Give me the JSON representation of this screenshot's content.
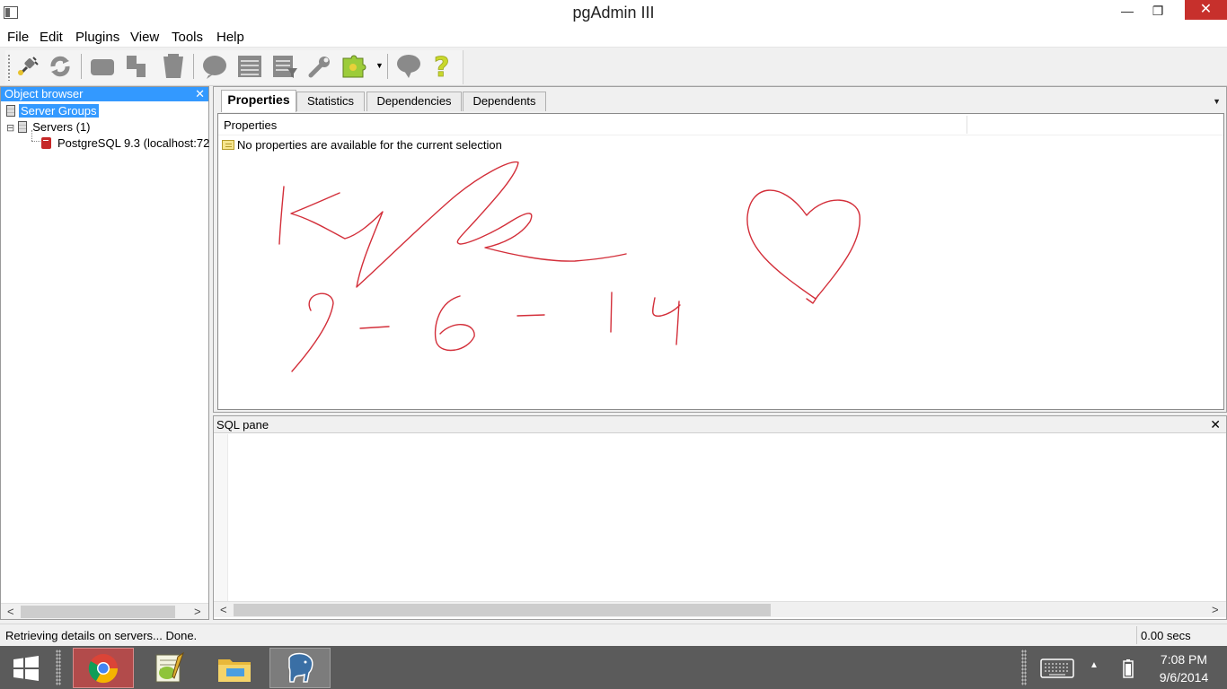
{
  "window": {
    "title": "pgAdmin III"
  },
  "window_controls": {
    "minimize": "—",
    "maximize": "❐",
    "close": "✕"
  },
  "menu": [
    "File",
    "Edit",
    "Plugins",
    "View",
    "Tools",
    "Help"
  ],
  "toolbar": {
    "icons": [
      "connect-icon",
      "refresh-icon",
      "properties-icon",
      "create-object-icon",
      "drop-object-icon",
      "sql-icon",
      "view-data-icon",
      "view-filtered-data-icon",
      "maintenance-icon",
      "plugins-icon",
      "hint-icon",
      "help-icon"
    ]
  },
  "object_browser": {
    "title": "Object browser",
    "close": "✕",
    "tree": {
      "root": "Server Groups",
      "servers": "Servers (1)",
      "server": "PostgreSQL 9.3 (localhost:72"
    },
    "expander": "⊟"
  },
  "tabs": [
    {
      "label": "Properties",
      "active": true
    },
    {
      "label": "Statistics",
      "active": false
    },
    {
      "label": "Dependencies",
      "active": false
    },
    {
      "label": "Dependents",
      "active": false
    }
  ],
  "tab_dropdown": "▼",
  "properties": {
    "column_header": "Properties",
    "message": "No properties are available for the current selection"
  },
  "sql_pane": {
    "title": "SQL pane",
    "close": "✕",
    "content": ""
  },
  "scroll": {
    "left_arrow": "<",
    "right_arrow": ">"
  },
  "statusbar": {
    "message": "Retrieving details on servers... Done.",
    "timing": "0.00 secs"
  },
  "taskbar": {
    "apps": [
      "windows-start-icon",
      "chrome-icon",
      "notepad-plus-icon",
      "file-explorer-icon",
      "pgadmin-elephant-icon"
    ],
    "keyboard_icon": "touch-keyboard-icon",
    "tray_arrow": "▲",
    "battery_icon": "battery-icon",
    "time": "7:08 PM",
    "date": "9/6/2014"
  },
  "colors": {
    "accent": "#3399ff",
    "close_red": "#c7302c",
    "ink": "#d32f3a",
    "taskbar": "#5b5b5b"
  }
}
